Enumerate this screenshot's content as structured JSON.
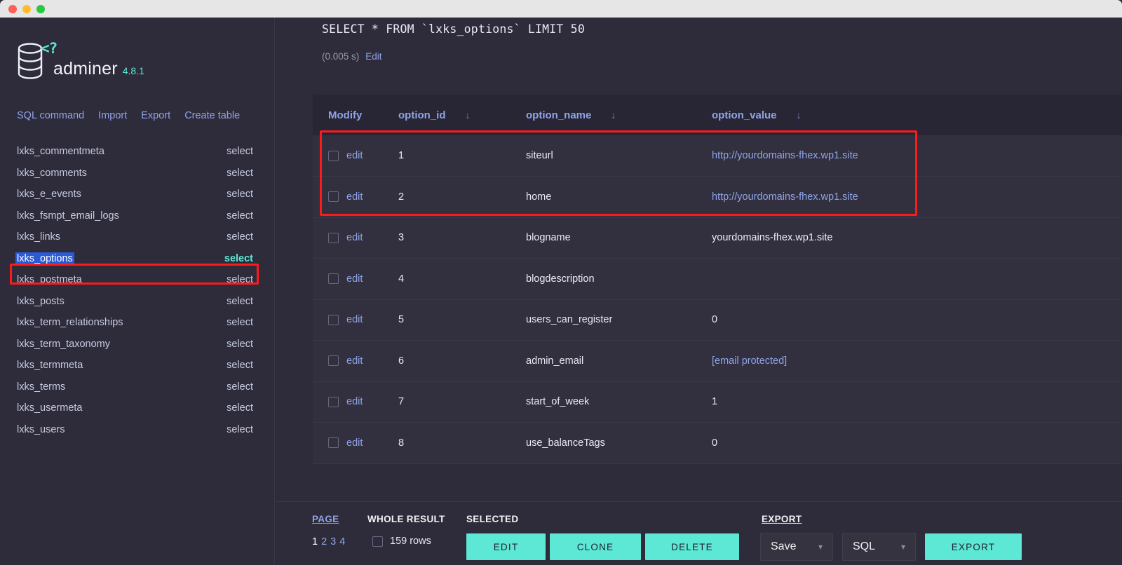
{
  "window": {
    "traffic_lights": [
      "close",
      "minimize",
      "zoom"
    ]
  },
  "sidebar": {
    "brand_name": "adminer",
    "brand_version": "4.8.1",
    "logo_icon": "database-icon",
    "logo_badge": "<?",
    "topnav": [
      {
        "label": "SQL command",
        "name": "sql-command"
      },
      {
        "label": "Import",
        "name": "import"
      },
      {
        "label": "Export",
        "name": "export"
      },
      {
        "label": "Create table",
        "name": "create-table"
      }
    ],
    "select_label": "select",
    "tables": [
      {
        "name": "lxks_commentmeta",
        "active": false
      },
      {
        "name": "lxks_comments",
        "active": false
      },
      {
        "name": "lxks_e_events",
        "active": false
      },
      {
        "name": "lxks_fsmpt_email_logs",
        "active": false
      },
      {
        "name": "lxks_links",
        "active": false
      },
      {
        "name": "lxks_options",
        "active": true
      },
      {
        "name": "lxks_postmeta",
        "active": false
      },
      {
        "name": "lxks_posts",
        "active": false
      },
      {
        "name": "lxks_term_relationships",
        "active": false
      },
      {
        "name": "lxks_term_taxonomy",
        "active": false
      },
      {
        "name": "lxks_termmeta",
        "active": false
      },
      {
        "name": "lxks_terms",
        "active": false
      },
      {
        "name": "lxks_usermeta",
        "active": false
      },
      {
        "name": "lxks_users",
        "active": false
      }
    ]
  },
  "main": {
    "sql_query": "SELECT * FROM `lxks_options` LIMIT 50",
    "timing": "(0.005 s)",
    "edit_label": "Edit",
    "sort_arrow": "↓",
    "columns": [
      {
        "label": "Modify",
        "sortable": false
      },
      {
        "label": "option_id",
        "sortable": true
      },
      {
        "label": "option_name",
        "sortable": true
      },
      {
        "label": "option_value",
        "sortable": true
      }
    ],
    "edit_row_label": "edit",
    "rows": [
      {
        "option_id": "1",
        "option_name": "siteurl",
        "option_value": "http://yourdomains-fhex.wp1.site",
        "value_is_link": true
      },
      {
        "option_id": "2",
        "option_name": "home",
        "option_value": "http://yourdomains-fhex.wp1.site",
        "value_is_link": true
      },
      {
        "option_id": "3",
        "option_name": "blogname",
        "option_value": "yourdomains-fhex.wp1.site",
        "value_is_link": false
      },
      {
        "option_id": "4",
        "option_name": "blogdescription",
        "option_value": "",
        "value_is_link": false
      },
      {
        "option_id": "5",
        "option_name": "users_can_register",
        "option_value": "0",
        "value_is_link": false
      },
      {
        "option_id": "6",
        "option_name": "admin_email",
        "option_value": "[email protected]",
        "value_is_link": true
      },
      {
        "option_id": "7",
        "option_name": "start_of_week",
        "option_value": "1",
        "value_is_link": false
      },
      {
        "option_id": "8",
        "option_name": "use_balanceTags",
        "option_value": "0",
        "value_is_link": false
      }
    ]
  },
  "footer": {
    "page_label": "PAGE",
    "whole_result_label": "WHOLE RESULT",
    "selected_label": "SELECTED",
    "export_label": "EXPORT",
    "pages": [
      "1",
      "2",
      "3",
      "4"
    ],
    "current_page": "1",
    "rows_count": "159 rows",
    "buttons": {
      "edit": "EDIT",
      "clone": "CLONE",
      "delete": "DELETE",
      "export": "EXPORT"
    },
    "selects": {
      "output": "Save",
      "format": "SQL"
    }
  },
  "annotations": {
    "highlight_color": "#ff1a1a",
    "boxes": [
      {
        "name": "sidebar-selected-table"
      },
      {
        "name": "first-two-result-rows"
      }
    ]
  },
  "colors": {
    "accent": "#5ce8d5",
    "link": "#8fa4e8",
    "background": "#2e2c3b",
    "header_row": "#282634",
    "row": "#32303f",
    "selection": "#2a5bd7"
  }
}
